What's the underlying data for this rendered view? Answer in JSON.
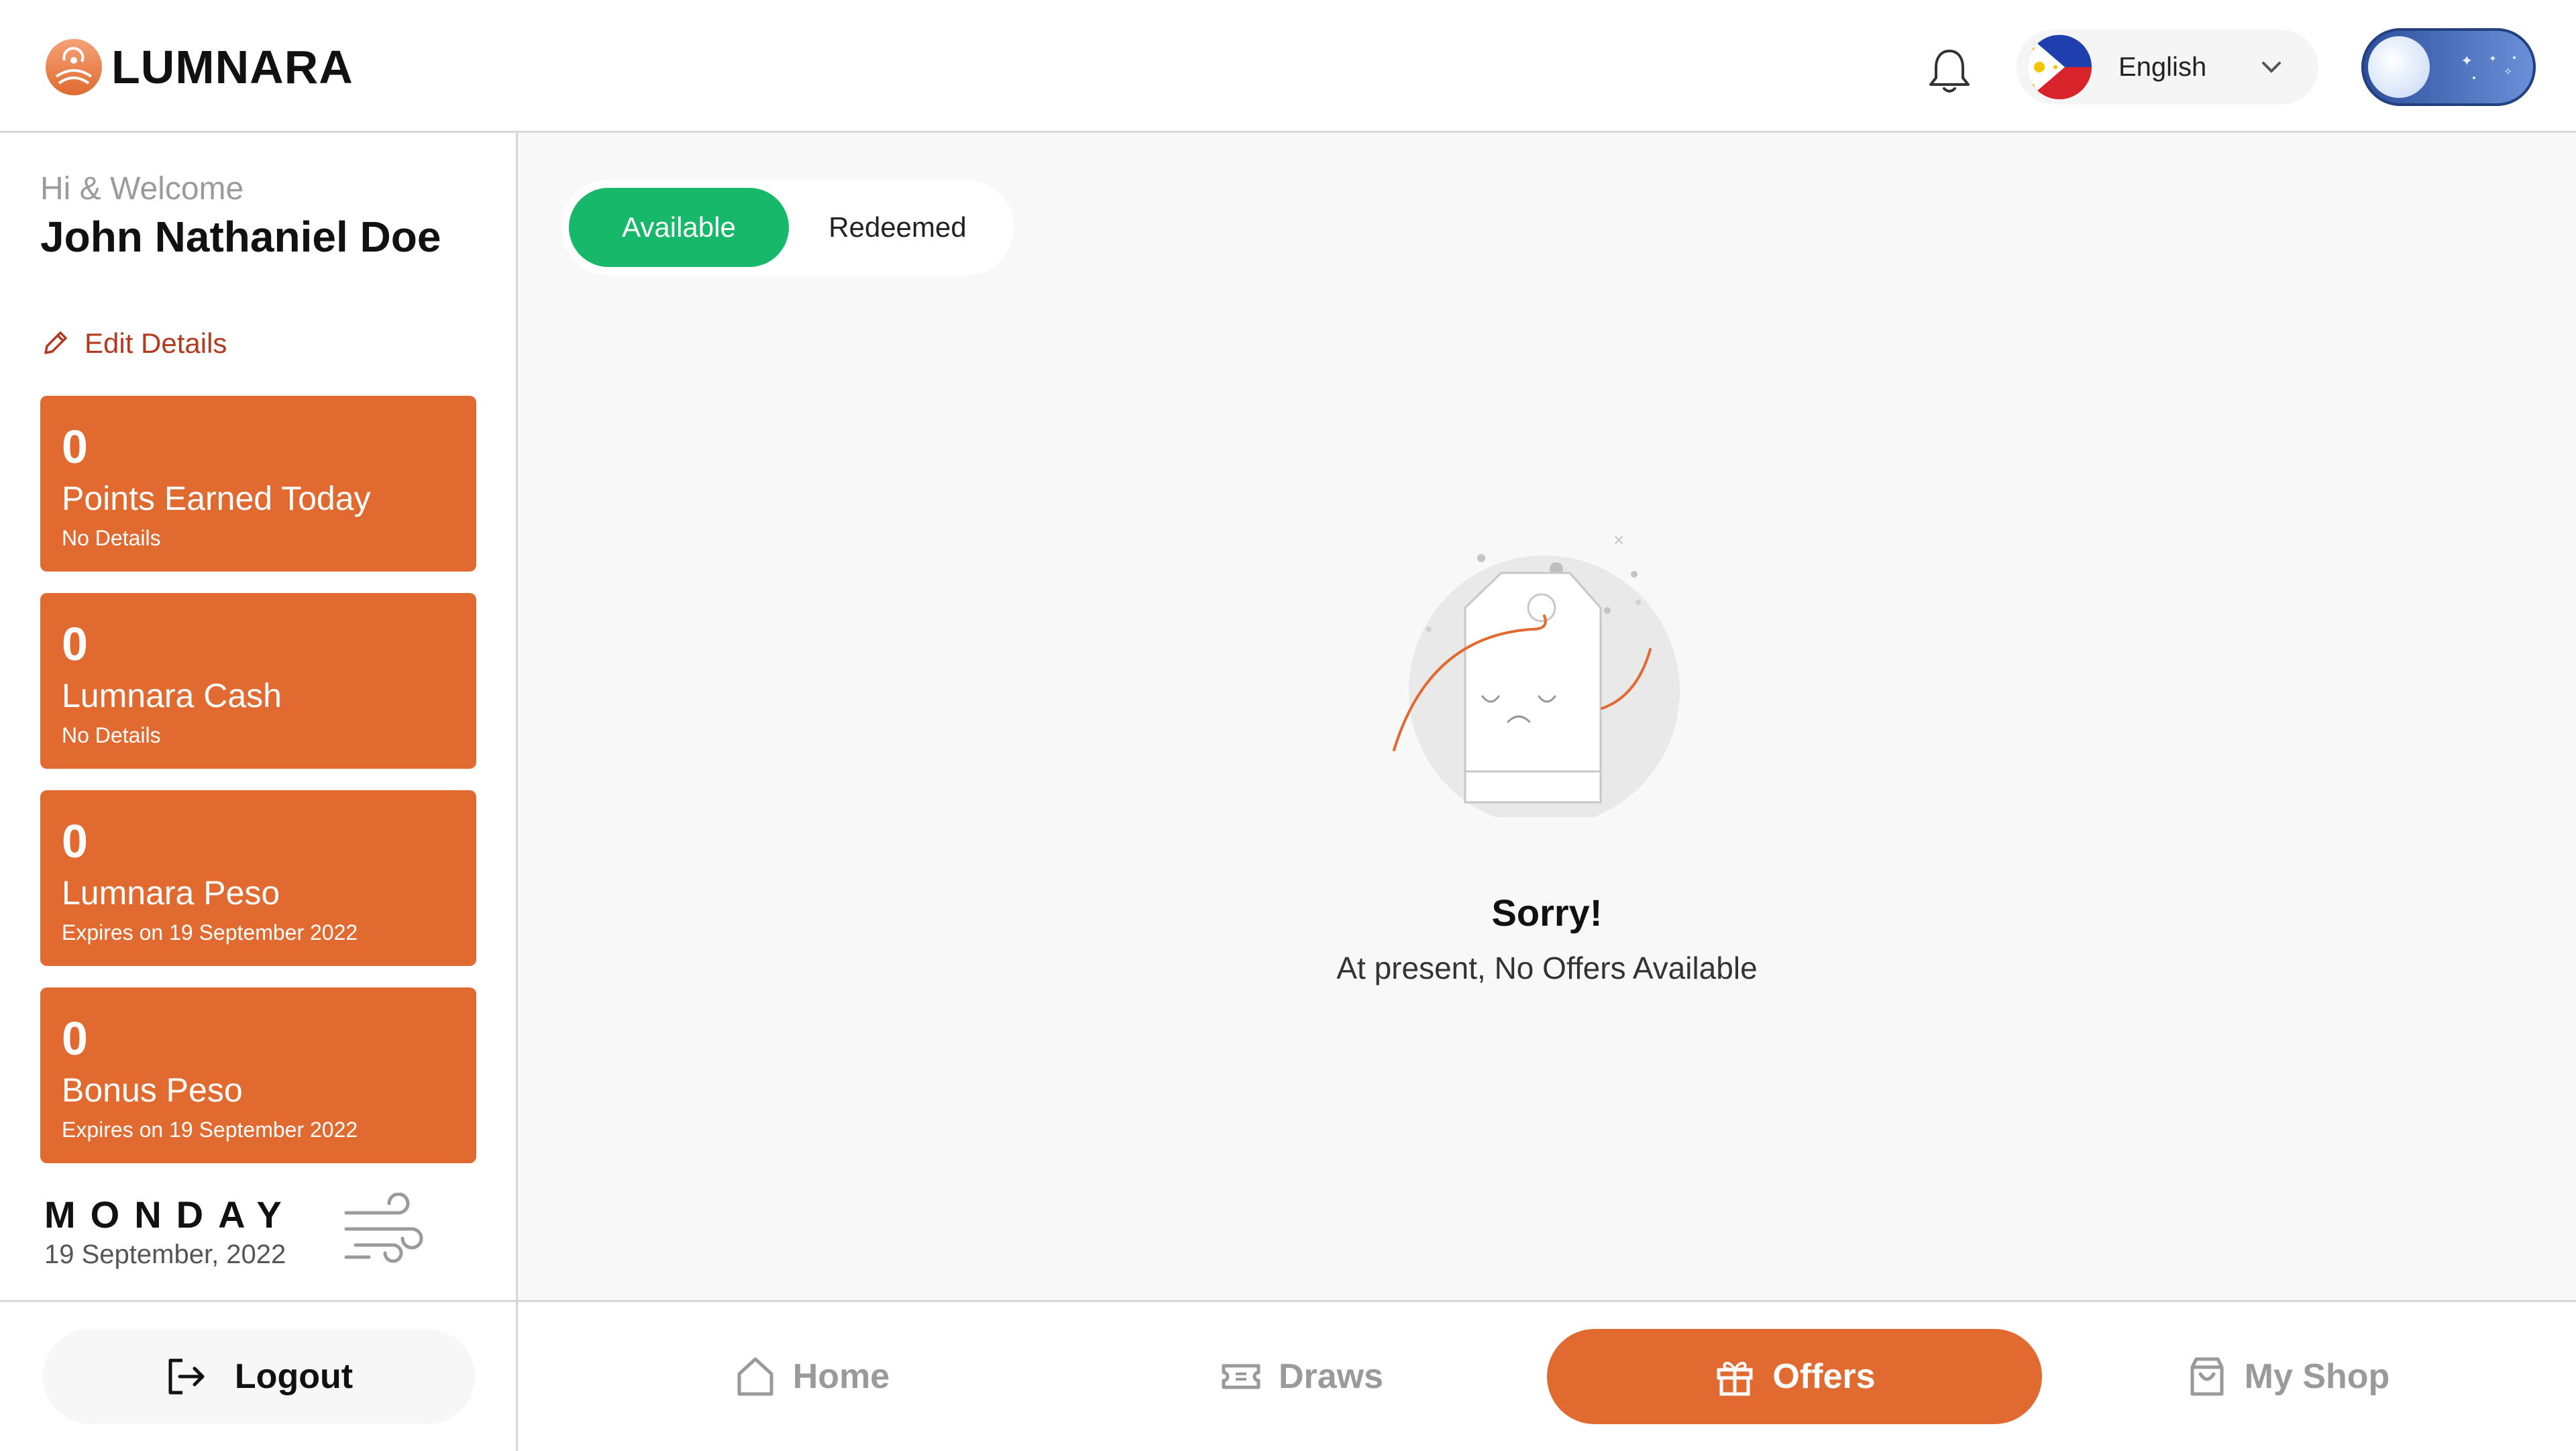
{
  "app": {
    "brand": "LUMNARA"
  },
  "header": {
    "language": "English",
    "icons": {
      "bell": "bell-icon",
      "flag": "philippines-flag-icon",
      "chevron": "chevron-down-icon",
      "theme_toggle": "night-mode-toggle"
    }
  },
  "sidebar": {
    "greeting": "Hi & Welcome",
    "username": "John Nathaniel Doe",
    "edit_label": "Edit Details",
    "cards": [
      {
        "value": "0",
        "label": "Points Earned Today",
        "sub": "No Details"
      },
      {
        "value": "0",
        "label": "Lumnara Cash",
        "sub": "No Details"
      },
      {
        "value": "0",
        "label": "Lumnara Peso",
        "sub": "Expires on 19 September 2022"
      },
      {
        "value": "0",
        "label": "Bonus Peso",
        "sub": "Expires on 19 September 2022"
      }
    ],
    "day": "MONDAY",
    "date": "19 September, 2022"
  },
  "main": {
    "tabs": [
      {
        "label": "Available",
        "active": true
      },
      {
        "label": "Redeemed",
        "active": false
      }
    ],
    "empty_title": "Sorry!",
    "empty_message": "At present, No Offers Available"
  },
  "footer": {
    "logout_label": "Logout",
    "nav": [
      {
        "label": "Home",
        "icon": "home-icon",
        "active": false
      },
      {
        "label": "Draws",
        "icon": "ticket-icon",
        "active": false
      },
      {
        "label": "Offers",
        "icon": "gift-icon",
        "active": true
      },
      {
        "label": "My Shop",
        "icon": "shopping-bag-icon",
        "active": false
      }
    ]
  },
  "colors": {
    "accent": "#e06a30",
    "active_tab": "#18b86a",
    "edit_link": "#b33a1f"
  }
}
